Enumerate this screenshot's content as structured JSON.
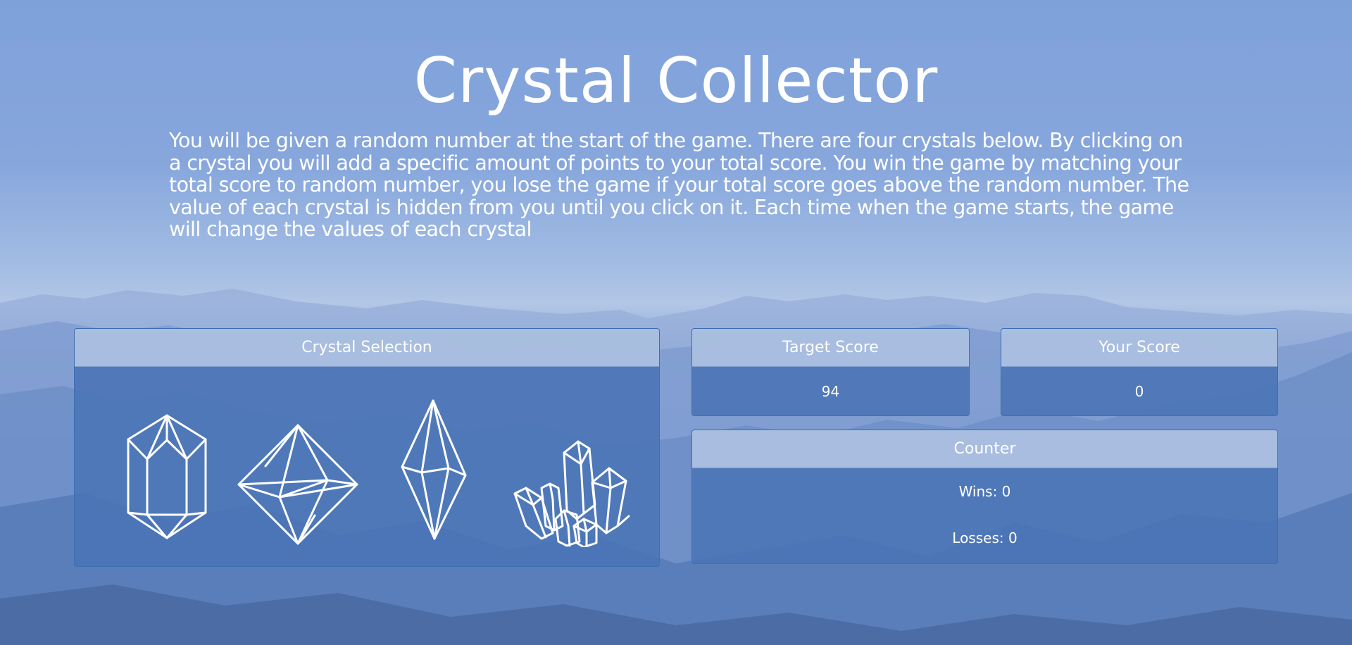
{
  "title": "Crystal Collector",
  "intro": "You will be given a random number at the start of the game. There are four crystals below. By clicking on a crystal you will add a specific amount of points to your total score. You win the game by matching your total score to random number, you lose the game if your total score goes above the random number. The value of each crystal is hidden from you until you click on it. Each time when the game starts, the game will change the values of each crystal",
  "crystal_panel": {
    "heading": "Crystal Selection",
    "crystals": [
      {
        "icon": "hexagonal-prism-crystal-icon"
      },
      {
        "icon": "octahedron-crystal-icon"
      },
      {
        "icon": "bipyramid-crystal-icon"
      },
      {
        "icon": "crystal-cluster-icon"
      }
    ]
  },
  "target_panel": {
    "heading": "Target Score",
    "value": "94"
  },
  "score_panel": {
    "heading": "Your Score",
    "value": "0"
  },
  "counter_panel": {
    "heading": "Counter",
    "wins": "Wins: 0",
    "losses": "Losses: 0"
  },
  "colors": {
    "panel_body": "#4a74b6",
    "panel_header": "#b0c3e2",
    "panel_border": "#3d6fb5",
    "text": "#ffffff"
  }
}
